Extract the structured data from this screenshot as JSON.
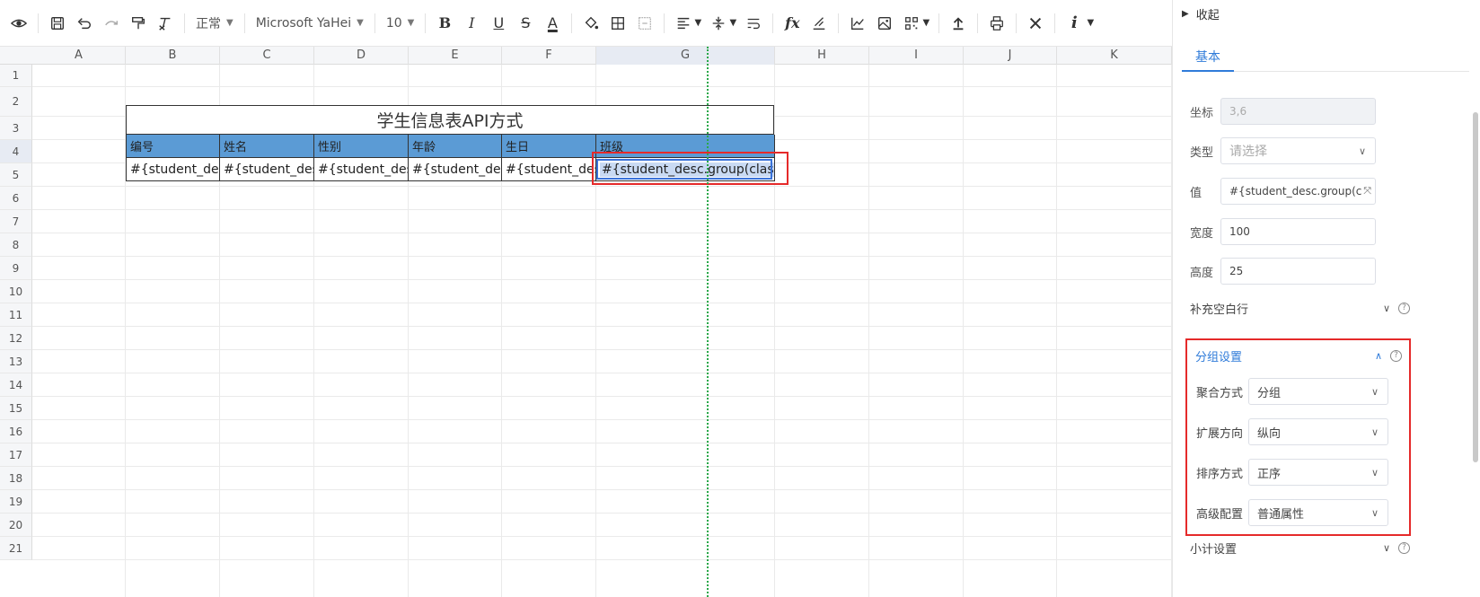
{
  "toolbar": {
    "style_select": "正常",
    "font_select": "Microsoft YaHei",
    "size_select": "10",
    "bold": "B",
    "italic": "I",
    "underline": "U",
    "strike": "S",
    "font_color": "A",
    "formula": "fx",
    "info": "i"
  },
  "sheet": {
    "columns": [
      "A",
      "B",
      "C",
      "D",
      "E",
      "F",
      "G",
      "H",
      "I",
      "J",
      "K"
    ],
    "rows": [
      "1",
      "2",
      "3",
      "4",
      "5",
      "6",
      "7",
      "8",
      "9",
      "10",
      "11",
      "12",
      "13",
      "14",
      "15",
      "16",
      "17",
      "18",
      "19",
      "20",
      "21"
    ],
    "title": "学生信息表API方式",
    "headers": [
      "编号",
      "姓名",
      "性别",
      "年龄",
      "生日",
      "班级"
    ],
    "data": [
      "#{student_des",
      "#{student_des",
      "#{student_des",
      "#{student_des",
      "#{student_des",
      "#{student_desc.group(classn"
    ]
  },
  "panel": {
    "collapse_label": "收起",
    "tab_basic": "基本",
    "coord_label": "坐标",
    "coord_value": "3,6",
    "type_label": "类型",
    "type_placeholder": "请选择",
    "value_label": "值",
    "value_value": "#{student_desc.group(c",
    "width_label": "宽度",
    "width_value": "100",
    "height_label": "高度",
    "height_value": "25",
    "fill_blank_label": "补充空白行",
    "group_section_label": "分组设置",
    "agg_label": "聚合方式",
    "agg_value": "分组",
    "expand_label": "扩展方向",
    "expand_value": "纵向",
    "sort_label": "排序方式",
    "sort_value": "正序",
    "adv_label": "高级配置",
    "adv_value": "普通属性",
    "subtotal_label": "小计设置"
  },
  "colors": {
    "header_fill": "#5b9bd5",
    "accent": "#2f7bd9",
    "highlight_red": "#e52a2a",
    "selection": "#3a72d8",
    "guide_line": "#2aa84a"
  }
}
